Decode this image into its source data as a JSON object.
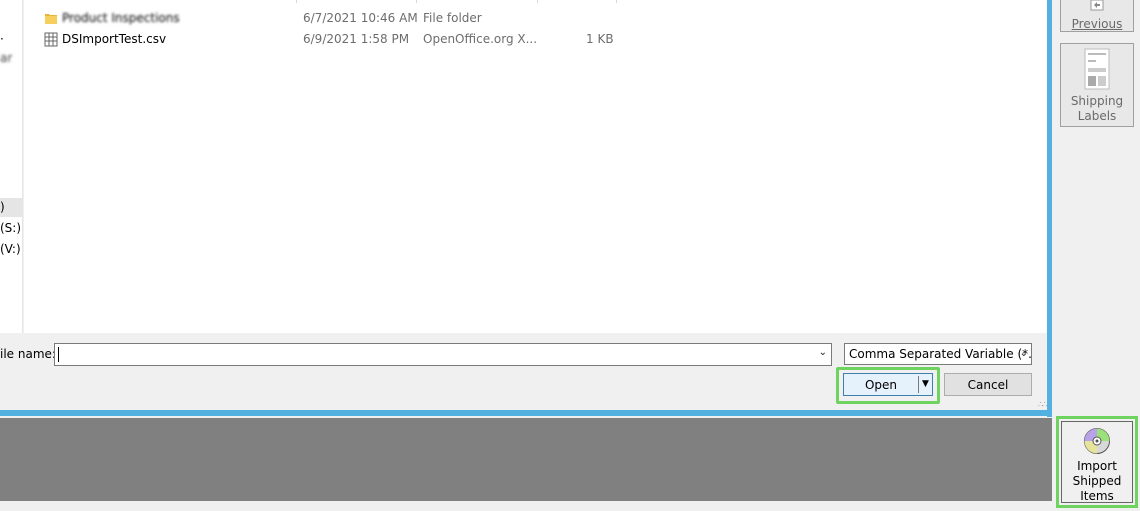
{
  "nav": {
    "items": [
      {
        "label": "·"
      },
      {
        "label": "ar"
      },
      {
        "label": ")"
      },
      {
        "label": "(S:)"
      },
      {
        "label": "(V:)"
      }
    ]
  },
  "files": [
    {
      "name": "Product Inspections",
      "date": "6/7/2021 10:46 AM",
      "type": "File folder",
      "size": "",
      "icon": "folder-icon"
    },
    {
      "name": "DSImportTest.csv",
      "date": "6/9/2021 1:58 PM",
      "type": "OpenOffice.org X...",
      "size": "1 KB",
      "icon": "spreadsheet-file-icon"
    }
  ],
  "dialog": {
    "file_name_label": "ile name:",
    "file_name_value": "",
    "file_type_value": "Comma Separated Variable (*.C",
    "open_label": "Open",
    "cancel_label": "Cancel"
  },
  "toolbar": {
    "previous_label": "Previous",
    "shipping_labels_line1": "Shipping",
    "shipping_labels_line2": "Labels",
    "import_line1": "Import",
    "import_line2": "Shipped",
    "import_line3": "Items"
  },
  "colors": {
    "dialog_border": "#52b1e0",
    "highlight": "#6fd35f",
    "underlay_gray": "#808080"
  }
}
